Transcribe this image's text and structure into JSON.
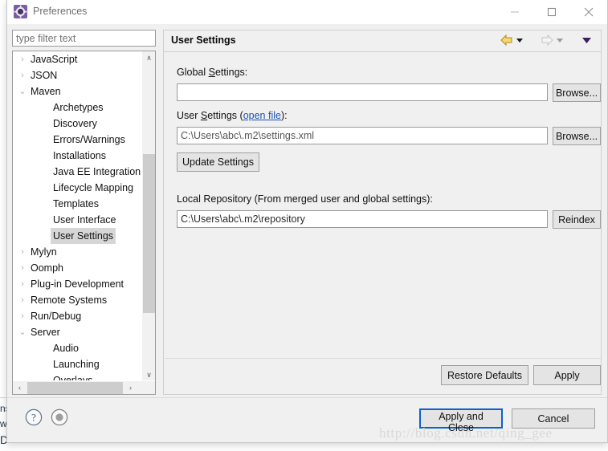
{
  "window": {
    "title": "Preferences",
    "icon": "preferences-gear-icon",
    "minimize_label": "—",
    "maximize_label": "□",
    "close_label": "✕"
  },
  "filter": {
    "placeholder": "type filter text",
    "value": ""
  },
  "tree": {
    "items": [
      {
        "label": "JavaScript",
        "depth": 0,
        "twisty": "collapsed",
        "selected": false
      },
      {
        "label": "JSON",
        "depth": 0,
        "twisty": "collapsed",
        "selected": false
      },
      {
        "label": "Maven",
        "depth": 0,
        "twisty": "expanded",
        "selected": false
      },
      {
        "label": "Archetypes",
        "depth": 1,
        "twisty": "none",
        "selected": false
      },
      {
        "label": "Discovery",
        "depth": 1,
        "twisty": "none",
        "selected": false
      },
      {
        "label": "Errors/Warnings",
        "depth": 1,
        "twisty": "none",
        "selected": false
      },
      {
        "label": "Installations",
        "depth": 1,
        "twisty": "none",
        "selected": false
      },
      {
        "label": "Java EE Integration",
        "depth": 1,
        "twisty": "none",
        "selected": false
      },
      {
        "label": "Lifecycle Mapping",
        "depth": 1,
        "twisty": "none",
        "selected": false
      },
      {
        "label": "Templates",
        "depth": 1,
        "twisty": "none",
        "selected": false
      },
      {
        "label": "User Interface",
        "depth": 1,
        "twisty": "none",
        "selected": false
      },
      {
        "label": "User Settings",
        "depth": 1,
        "twisty": "none",
        "selected": true
      },
      {
        "label": "Mylyn",
        "depth": 0,
        "twisty": "collapsed",
        "selected": false
      },
      {
        "label": "Oomph",
        "depth": 0,
        "twisty": "collapsed",
        "selected": false
      },
      {
        "label": "Plug-in Development",
        "depth": 0,
        "twisty": "collapsed",
        "selected": false
      },
      {
        "label": "Remote Systems",
        "depth": 0,
        "twisty": "collapsed",
        "selected": false
      },
      {
        "label": "Run/Debug",
        "depth": 0,
        "twisty": "collapsed",
        "selected": false
      },
      {
        "label": "Server",
        "depth": 0,
        "twisty": "expanded",
        "selected": false
      },
      {
        "label": "Audio",
        "depth": 1,
        "twisty": "none",
        "selected": false
      },
      {
        "label": "Launching",
        "depth": 1,
        "twisty": "none",
        "selected": false
      },
      {
        "label": "Overlays",
        "depth": 1,
        "twisty": "none",
        "selected": false
      }
    ],
    "twisty_glyphs": {
      "collapsed": "›",
      "expanded": "⌄",
      "none": ""
    },
    "vscroll_up": "∧",
    "vscroll_down": "∨",
    "hscroll_left": "‹",
    "hscroll_right": "›"
  },
  "content": {
    "title": "User Settings",
    "nav": {
      "back": "back-arrow",
      "back_dropdown": "back-history-dropdown",
      "forward": "forward-arrow",
      "forward_dropdown": "forward-history-dropdown",
      "menu": "view-menu-dropdown"
    },
    "global_settings": {
      "label_pre": "Global ",
      "label_mnemonic": "S",
      "label_post": "ettings:",
      "value": "",
      "browse_label": "Browse..."
    },
    "user_settings": {
      "label_pre": "User ",
      "label_mnemonic": "S",
      "label_mid": "ettings (",
      "link_label": "open file",
      "label_post": "):",
      "value": "C:\\Users\\abc\\.m2\\settings.xml",
      "browse_label": "Browse...",
      "update_label": "Update Settings"
    },
    "local_repository": {
      "label": "Local Repository (From merged user and global settings):",
      "value": "C:\\Users\\abc\\.m2\\repository",
      "reindex_label": "Reindex"
    },
    "restore_defaults_label": "Restore Defaults",
    "apply_label": "Apply"
  },
  "footer": {
    "help_icon": "help-question-icon",
    "tips_icon": "tips-circle-icon",
    "apply_and_close_label": "Apply and Close",
    "cancel_label": "Cancel"
  },
  "watermark": "http://blog.csdn.net/qing_gee",
  "background_window": {
    "fragments": [
      "ns",
      "w",
      "D"
    ]
  },
  "colors": {
    "dialog_bg": "#f0f0f0",
    "field_bg": "#ffffff",
    "accent_focus": "#0a64c8",
    "link": "#1b53b5",
    "selection": "#d6d6d6",
    "nav_back": "#f0c419",
    "nav_disabled": "#c4c4c4",
    "title_icon": "#6b4e9e"
  }
}
